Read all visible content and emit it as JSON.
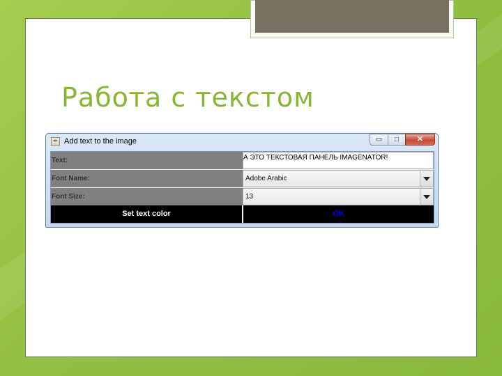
{
  "slide": {
    "title": "Работа с текстом"
  },
  "window": {
    "title": "Add text to the image",
    "controls": {
      "minimize": "▭",
      "maximize": "□",
      "close": "✕"
    },
    "text_label": "Text:",
    "text_value": "А ЭТО ТЕКСТОВАЯ ПАНЕЛЬ IMAGENATOR!",
    "font_name_label": "Font Name:",
    "font_name_value": "Adobe Arabic",
    "font_size_label": "Font Size:",
    "font_size_value": "13",
    "set_color_label": "Set text color",
    "ok_label": "OK"
  },
  "colors": {
    "title_green": "#8ab534",
    "ok_text": "#0000ff",
    "set_color_text": "#ffffff",
    "label_bg": "#808080"
  },
  "icons": {
    "app": "java-coffee-icon",
    "dropdown": "triangle-down-icon"
  }
}
